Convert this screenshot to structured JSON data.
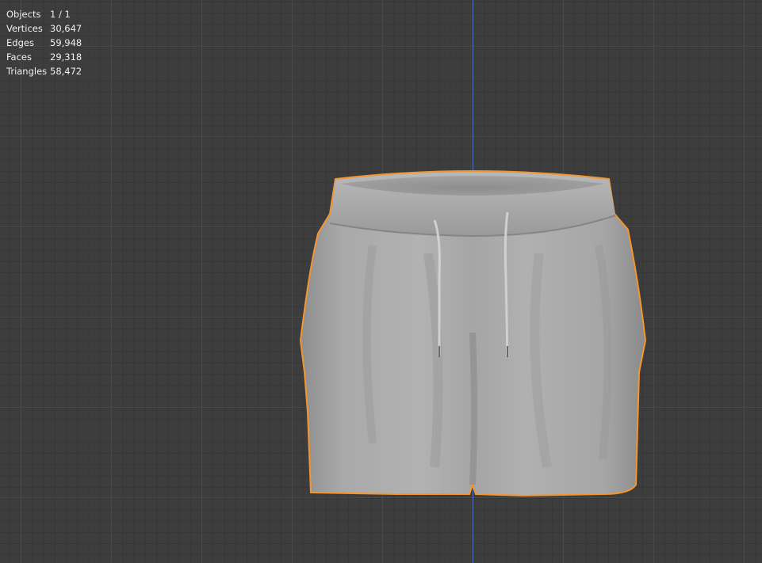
{
  "stats": [
    {
      "label": "Objects",
      "value": "1 / 1"
    },
    {
      "label": "Vertices",
      "value": "30,647"
    },
    {
      "label": "Edges",
      "value": "59,948"
    },
    {
      "label": "Faces",
      "value": "29,318"
    },
    {
      "label": "Triangles",
      "value": "58,472"
    }
  ],
  "colors": {
    "background": "#3d3d3d",
    "selection_outline": "#f5952e",
    "z_axis": "#4f6fb5",
    "mesh": "#a8a8a8"
  }
}
